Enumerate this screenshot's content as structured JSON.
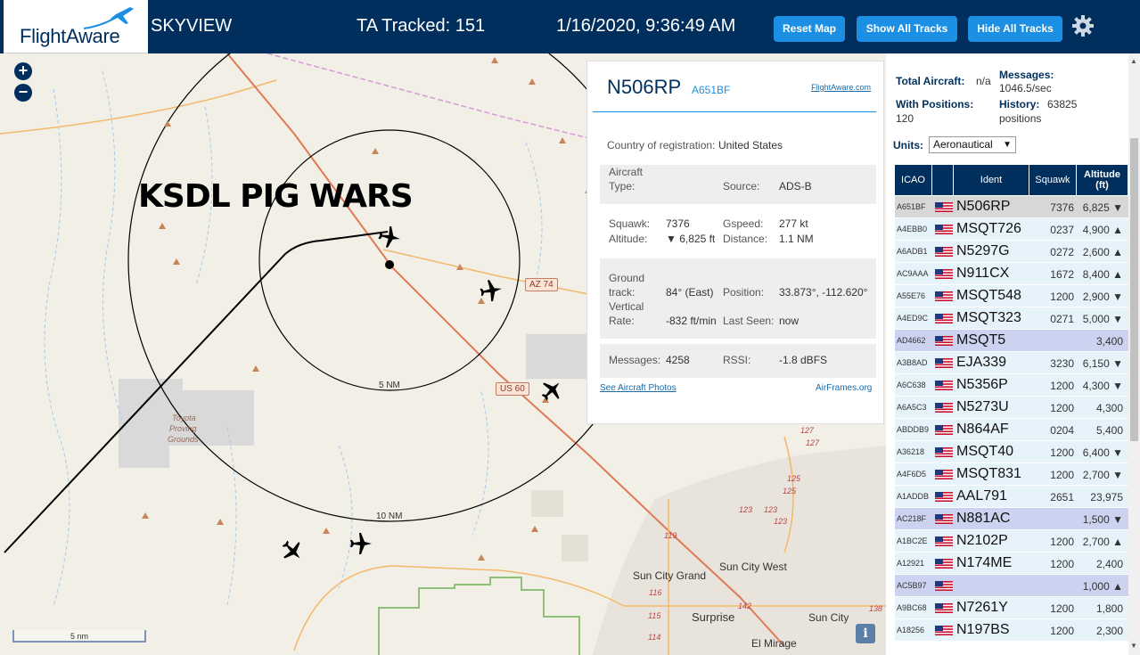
{
  "header": {
    "logo_text": "FlightAware",
    "site_name": "SKYVIEW",
    "tracked": "TA Tracked: 151",
    "datetime": "1/16/2020, 9:36:49 AM",
    "buttons": {
      "reset": "Reset Map",
      "show_all": "Show All Tracks",
      "hide_all": "Hide All Tracks"
    },
    "settings_icon": "gear-icon"
  },
  "map": {
    "zoom_in": "+",
    "zoom_out": "−",
    "overlay_title": "KSDL PIG WARS",
    "ring_inner": "5 NM",
    "ring_outer": "10 NM",
    "highways": [
      "AZ 74",
      "US 60"
    ],
    "areas": [
      "Toyota",
      "Proving",
      "Grounds"
    ],
    "cities": [
      "Sun City West",
      "Sun City Grand",
      "Surprise",
      "Sun City",
      "El Mirage"
    ],
    "road_numbers": [
      "127",
      "127",
      "125",
      "125",
      "123",
      "123",
      "123",
      "119",
      "116",
      "115",
      "114",
      "142",
      "138"
    ],
    "scale": "5 nm",
    "info_icon": "i"
  },
  "popup": {
    "ident": "N506RP",
    "hex": "A651BF",
    "link": "FlightAware.com",
    "country_label": "Country of registration:",
    "country_value": "United States",
    "aircraft_type_label1": "Aircraft",
    "aircraft_type_label2": "Type:",
    "source_label": "Source:",
    "source_value": "ADS-B",
    "squawk_label": "Squawk:",
    "squawk_value": "7376",
    "gspeed_label": "Gspeed:",
    "gspeed_value": "277 kt",
    "altitude_label": "Altitude:",
    "altitude_value": "▼ 6,825 ft",
    "distance_label": "Distance:",
    "distance_value": "1.1 NM",
    "ground_label1": "Ground",
    "ground_label2": "track:",
    "ground_value": "84° (East)",
    "position_label": "Position:",
    "position_value": "33.873°, -112.620°",
    "vert_label1": "Vertical",
    "vert_label2": "Rate:",
    "vert_value": "-832 ft/min",
    "lastseen_label": "Last Seen:",
    "lastseen_value": "now",
    "messages_label": "Messages:",
    "messages_value": "4258",
    "rssi_label": "RSSI:",
    "rssi_value": "-1.8 dBFS",
    "photos_link": "See Aircraft Photos",
    "airframes_link": "AirFrames.org"
  },
  "panel": {
    "total_label": "Total Aircraft:",
    "total_value": "n/a",
    "messages_label": "Messages:",
    "messages_value": "1046.5/sec",
    "positions_label": "With Positions:",
    "positions_value": "120",
    "history_label": "History:",
    "history_value": "63825",
    "history_unit": "positions",
    "units_label": "Units:",
    "units_value": "Aeronautical",
    "columns": [
      "ICAO",
      "",
      "Ident",
      "Squawk",
      "Altitude (ft)"
    ],
    "rows": [
      {
        "icao": "A651BF",
        "ident": "N506RP",
        "squawk": "7376",
        "alt": "6,825 ▼",
        "bg": "#d7d7d7"
      },
      {
        "icao": "A4EBB0",
        "ident": "MSQT726",
        "squawk": "0237",
        "alt": "4,900 ▲",
        "bg": "#e6f3fb"
      },
      {
        "icao": "A6ADB1",
        "ident": "N5297G",
        "squawk": "0272",
        "alt": "2,600 ▲",
        "bg": "#e6f3fb"
      },
      {
        "icao": "AC9AAA",
        "ident": "N911CX",
        "squawk": "1672",
        "alt": "8,400 ▲",
        "bg": "#e6f3fb"
      },
      {
        "icao": "A55E76",
        "ident": "MSQT548",
        "squawk": "1200",
        "alt": "2,900 ▼",
        "bg": "#e6f3fb"
      },
      {
        "icao": "A4ED9C",
        "ident": "MSQT323",
        "squawk": "0271",
        "alt": "5,000 ▼",
        "bg": "#e6f3fb"
      },
      {
        "icao": "AD4662",
        "ident": "MSQT5",
        "squawk": "",
        "alt": "3,400",
        "bg": "#ccd3f0"
      },
      {
        "icao": "A3B8AD",
        "ident": "EJA339",
        "squawk": "3230",
        "alt": "6,150 ▼",
        "bg": "#e6f3fb"
      },
      {
        "icao": "A6C638",
        "ident": "N5356P",
        "squawk": "1200",
        "alt": "4,300 ▼",
        "bg": "#e6f3fb"
      },
      {
        "icao": "A6A5C3",
        "ident": "N5273U",
        "squawk": "1200",
        "alt": "4,300",
        "bg": "#e6f3fb"
      },
      {
        "icao": "ABDDB9",
        "ident": "N864AF",
        "squawk": "0204",
        "alt": "5,400",
        "bg": "#e6f3fb"
      },
      {
        "icao": "A36218",
        "ident": "MSQT40",
        "squawk": "1200",
        "alt": "6,400 ▼",
        "bg": "#e6f3fb"
      },
      {
        "icao": "A4F6D5",
        "ident": "MSQT831",
        "squawk": "1200",
        "alt": "2,700 ▼",
        "bg": "#e6f3fb"
      },
      {
        "icao": "A1ADDB",
        "ident": "AAL791",
        "squawk": "2651",
        "alt": "23,975",
        "bg": "#e6f3fb"
      },
      {
        "icao": "AC218F",
        "ident": "N881AC",
        "squawk": "",
        "alt": "1,500 ▼",
        "bg": "#ccd3f0"
      },
      {
        "icao": "A1BC2E",
        "ident": "N2102P",
        "squawk": "1200",
        "alt": "2,700 ▲",
        "bg": "#e6f3fb"
      },
      {
        "icao": "A12921",
        "ident": "N174ME",
        "squawk": "1200",
        "alt": "2,400",
        "bg": "#e6f3fb"
      },
      {
        "icao": "AC5B97",
        "ident": "",
        "squawk": "",
        "alt": "1,000 ▲",
        "bg": "#ccd3f0"
      },
      {
        "icao": "A9BC68",
        "ident": "N7261Y",
        "squawk": "1200",
        "alt": "1,800",
        "bg": "#e6f3fb"
      },
      {
        "icao": "A18256",
        "ident": "N197BS",
        "squawk": "1200",
        "alt": "2,300",
        "bg": "#e6f3fb"
      }
    ]
  },
  "colors": {
    "header_bg": "#002f5d",
    "button_bg": "#1b8fe4",
    "row_bg": "#e6f3fb",
    "row_unsquawked": "#ccd3f0"
  }
}
